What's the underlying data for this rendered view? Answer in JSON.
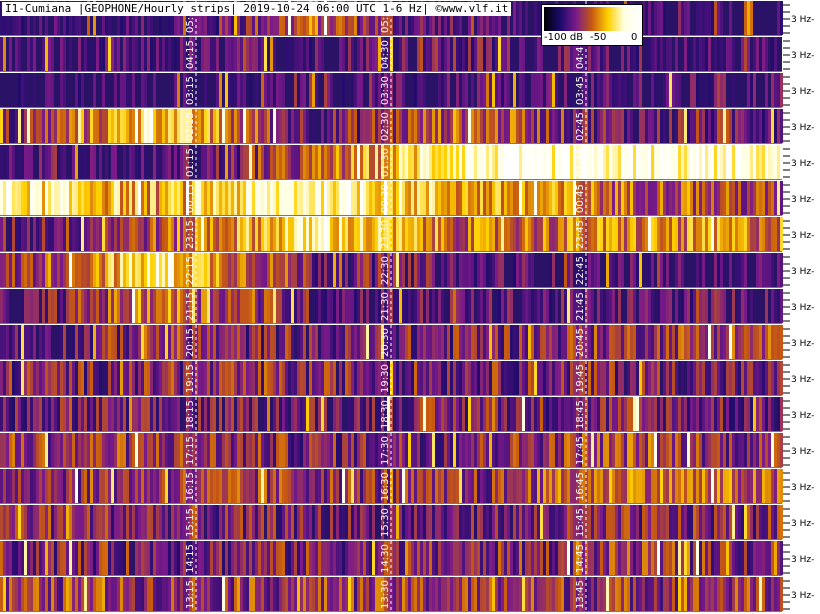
{
  "chart_data": {
    "type": "heatmap",
    "title": "I1-Cumiana |GEOPHONE/Hourly strips| 2019-10-24 06:00 UTC 1-6 Hz| ©www.vlf.it",
    "frequency_tick_label": "3 Hz",
    "colorbar": {
      "ticks": [
        "-100 dB",
        "-50",
        "0"
      ],
      "colors": [
        "#000000",
        "#1a0a6b",
        "#7a1a8a",
        "#c85a10",
        "#ffd000",
        "#ffffe0",
        "#ffffff"
      ]
    },
    "background_color": "#2a1266",
    "strips": [
      {
        "hour": "05",
        "markers": [
          "05:15",
          "05:30",
          "05:45"
        ],
        "activity": [
          0.15,
          0.2,
          0.5,
          0.2,
          0.15,
          0.15
        ]
      },
      {
        "hour": "04",
        "markers": [
          "04:15",
          "04:30",
          "04:45"
        ],
        "activity": [
          0.2,
          0.2,
          0.25,
          0.3,
          0.2,
          0.2
        ]
      },
      {
        "hour": "03",
        "markers": [
          "03:15",
          "03:30",
          "03:45"
        ],
        "activity": [
          0.15,
          0.15,
          0.2,
          0.2,
          0.2,
          0.25
        ]
      },
      {
        "hour": "02",
        "markers": [
          "02:15",
          "02:30",
          "02:45"
        ],
        "activity": [
          0.3,
          0.7,
          0.3,
          0.5,
          0.3,
          0.35
        ]
      },
      {
        "hour": "01",
        "markers": [
          "01:15",
          "01:30",
          "01:45"
        ],
        "activity": [
          0.25,
          0.2,
          0.45,
          0.85,
          0.85,
          0.85
        ]
      },
      {
        "hour": "00",
        "markers": [
          "00:15",
          "00:30",
          "00:45"
        ],
        "activity": [
          0.8,
          0.6,
          0.85,
          0.6,
          0.5,
          0.4
        ]
      },
      {
        "hour": "23",
        "markers": [
          "23:15",
          "23:30",
          "23:45"
        ],
        "activity": [
          0.3,
          0.45,
          0.75,
          0.5,
          0.55,
          0.55
        ]
      },
      {
        "hour": "22",
        "markers": [
          "22:15",
          "22:30",
          "22:45"
        ],
        "activity": [
          0.35,
          0.75,
          0.35,
          0.25,
          0.2,
          0.2
        ]
      },
      {
        "hour": "21",
        "markers": [
          "21:15",
          "21:30",
          "21:45"
        ],
        "activity": [
          0.2,
          0.55,
          0.3,
          0.25,
          0.25,
          0.25
        ]
      },
      {
        "hour": "20",
        "markers": [
          "20:15",
          "20:30",
          "20:45"
        ],
        "activity": [
          0.25,
          0.4,
          0.3,
          0.35,
          0.4,
          0.45
        ]
      },
      {
        "hour": "19",
        "markers": [
          "19:15",
          "19:30",
          "19:45"
        ],
        "activity": [
          0.35,
          0.35,
          0.35,
          0.35,
          0.35,
          0.3
        ]
      },
      {
        "hour": "18",
        "markers": [
          "18:15",
          "18:30",
          "18:45"
        ],
        "activity": [
          0.3,
          0.3,
          0.3,
          0.35,
          0.35,
          0.3
        ]
      },
      {
        "hour": "17",
        "markers": [
          "17:15",
          "17:30",
          "17:45"
        ],
        "activity": [
          0.4,
          0.4,
          0.35,
          0.35,
          0.45,
          0.35
        ]
      },
      {
        "hour": "16",
        "markers": [
          "16:15",
          "16:30",
          "16:45"
        ],
        "activity": [
          0.4,
          0.4,
          0.4,
          0.35,
          0.55,
          0.45
        ]
      },
      {
        "hour": "15",
        "markers": [
          "15:15",
          "15:30",
          "15:45"
        ],
        "activity": [
          0.4,
          0.35,
          0.3,
          0.3,
          0.35,
          0.35
        ]
      },
      {
        "hour": "14",
        "markers": [
          "14:15",
          "14:30",
          "14:45"
        ],
        "activity": [
          0.35,
          0.35,
          0.35,
          0.35,
          0.4,
          0.35
        ]
      },
      {
        "hour": "13",
        "markers": [
          "13:15",
          "13:30",
          "13:45"
        ],
        "activity": [
          0.4,
          0.4,
          0.4,
          0.4,
          0.4,
          0.4
        ]
      }
    ]
  }
}
